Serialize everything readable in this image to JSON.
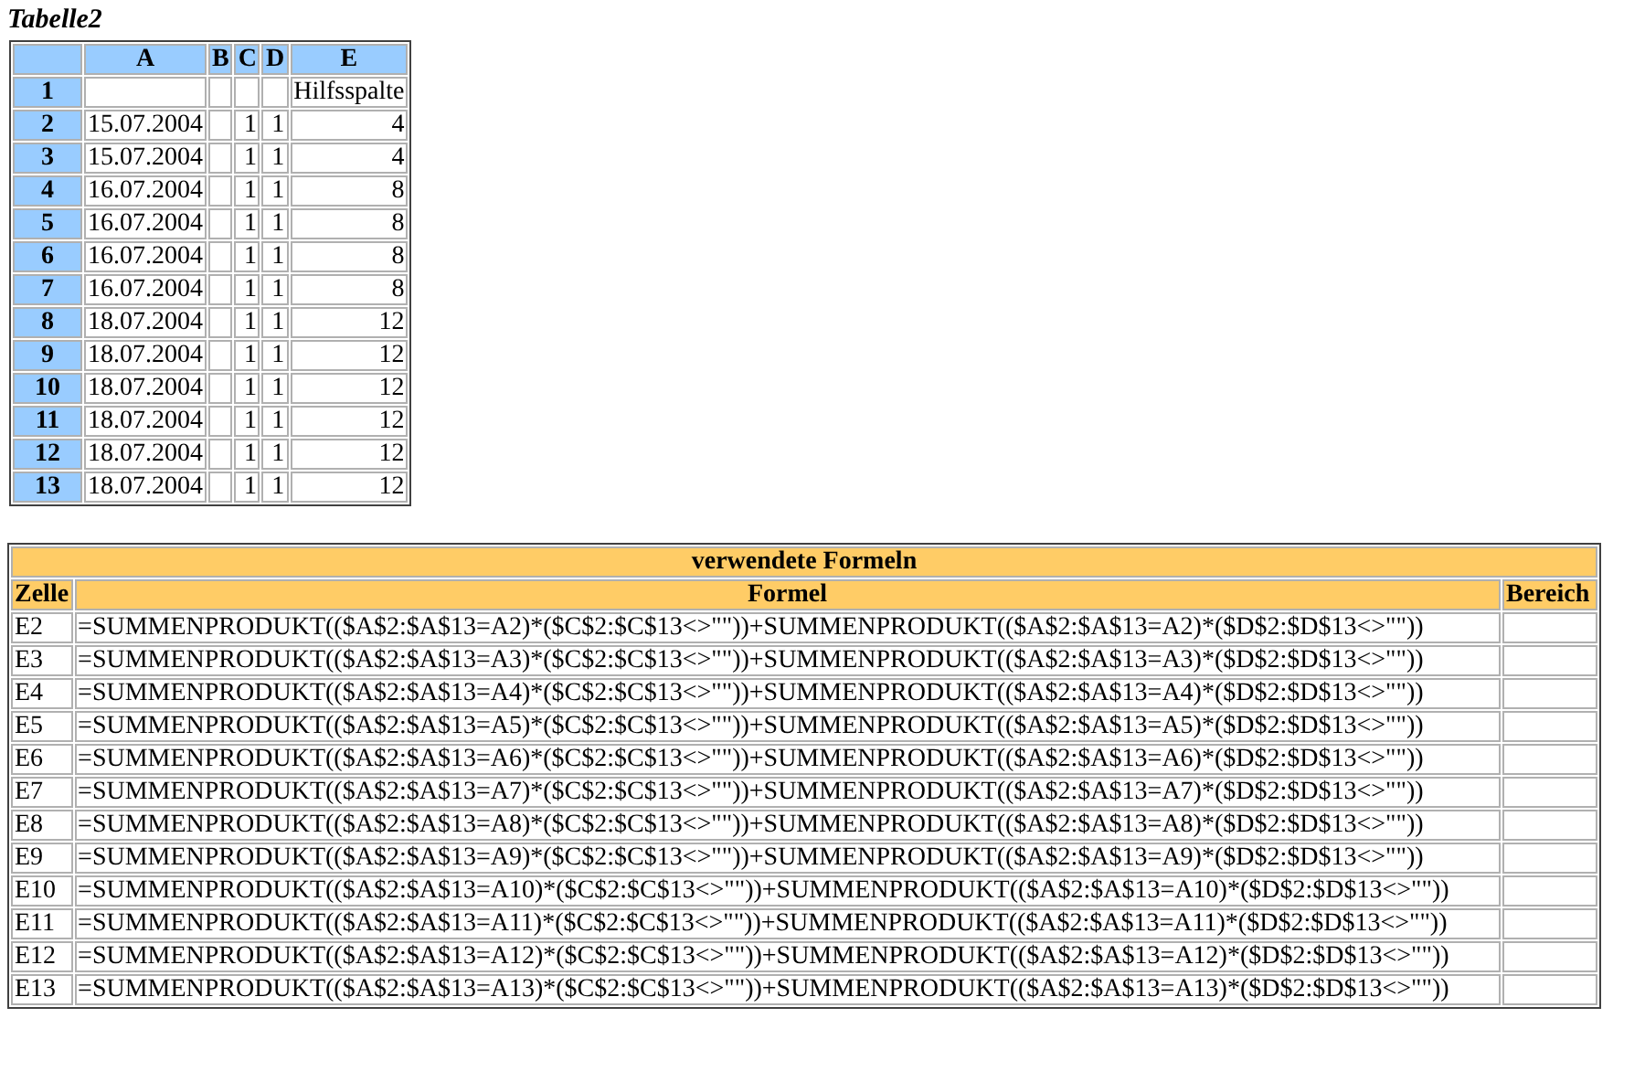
{
  "sheet": {
    "title": "Tabelle2",
    "columns": [
      "A",
      "B",
      "C",
      "D",
      "E"
    ],
    "rows": [
      {
        "number": "1",
        "cells": [
          "",
          "",
          "",
          "",
          "Hilfsspalte"
        ]
      },
      {
        "number": "2",
        "cells": [
          "15.07.2004",
          "",
          "1",
          "1",
          "4"
        ]
      },
      {
        "number": "3",
        "cells": [
          "15.07.2004",
          "",
          "1",
          "1",
          "4"
        ]
      },
      {
        "number": "4",
        "cells": [
          "16.07.2004",
          "",
          "1",
          "1",
          "8"
        ]
      },
      {
        "number": "5",
        "cells": [
          "16.07.2004",
          "",
          "1",
          "1",
          "8"
        ]
      },
      {
        "number": "6",
        "cells": [
          "16.07.2004",
          "",
          "1",
          "1",
          "8"
        ]
      },
      {
        "number": "7",
        "cells": [
          "16.07.2004",
          "",
          "1",
          "1",
          "8"
        ]
      },
      {
        "number": "8",
        "cells": [
          "18.07.2004",
          "",
          "1",
          "1",
          "12"
        ]
      },
      {
        "number": "9",
        "cells": [
          "18.07.2004",
          "",
          "1",
          "1",
          "12"
        ]
      },
      {
        "number": "10",
        "cells": [
          "18.07.2004",
          "",
          "1",
          "1",
          "12"
        ]
      },
      {
        "number": "11",
        "cells": [
          "18.07.2004",
          "",
          "1",
          "1",
          "12"
        ]
      },
      {
        "number": "12",
        "cells": [
          "18.07.2004",
          "",
          "1",
          "1",
          "12"
        ]
      },
      {
        "number": "13",
        "cells": [
          "18.07.2004",
          "",
          "1",
          "1",
          "12"
        ]
      }
    ]
  },
  "formulas": {
    "title": "verwendete Formeln",
    "columns": [
      "Zelle",
      "Formel",
      "Bereich"
    ],
    "rows": [
      {
        "cell": "E2",
        "formula": "=SUMMENPRODUKT(($A$2:$A$13=A2)*($C$2:$C$13<>\"\"))+SUMMENPRODUKT(($A$2:$A$13=A2)*($D$2:$D$13<>\"\"))"
      },
      {
        "cell": "E3",
        "formula": "=SUMMENPRODUKT(($A$2:$A$13=A3)*($C$2:$C$13<>\"\"))+SUMMENPRODUKT(($A$2:$A$13=A3)*($D$2:$D$13<>\"\"))"
      },
      {
        "cell": "E4",
        "formula": "=SUMMENPRODUKT(($A$2:$A$13=A4)*($C$2:$C$13<>\"\"))+SUMMENPRODUKT(($A$2:$A$13=A4)*($D$2:$D$13<>\"\"))"
      },
      {
        "cell": "E5",
        "formula": "=SUMMENPRODUKT(($A$2:$A$13=A5)*($C$2:$C$13<>\"\"))+SUMMENPRODUKT(($A$2:$A$13=A5)*($D$2:$D$13<>\"\"))"
      },
      {
        "cell": "E6",
        "formula": "=SUMMENPRODUKT(($A$2:$A$13=A6)*($C$2:$C$13<>\"\"))+SUMMENPRODUKT(($A$2:$A$13=A6)*($D$2:$D$13<>\"\"))"
      },
      {
        "cell": "E7",
        "formula": "=SUMMENPRODUKT(($A$2:$A$13=A7)*($C$2:$C$13<>\"\"))+SUMMENPRODUKT(($A$2:$A$13=A7)*($D$2:$D$13<>\"\"))"
      },
      {
        "cell": "E8",
        "formula": "=SUMMENPRODUKT(($A$2:$A$13=A8)*($C$2:$C$13<>\"\"))+SUMMENPRODUKT(($A$2:$A$13=A8)*($D$2:$D$13<>\"\"))"
      },
      {
        "cell": "E9",
        "formula": "=SUMMENPRODUKT(($A$2:$A$13=A9)*($C$2:$C$13<>\"\"))+SUMMENPRODUKT(($A$2:$A$13=A9)*($D$2:$D$13<>\"\"))"
      },
      {
        "cell": "E10",
        "formula": "=SUMMENPRODUKT(($A$2:$A$13=A10)*($C$2:$C$13<>\"\"))+SUMMENPRODUKT(($A$2:$A$13=A10)*($D$2:$D$13<>\"\"))"
      },
      {
        "cell": "E11",
        "formula": "=SUMMENPRODUKT(($A$2:$A$13=A11)*($C$2:$C$13<>\"\"))+SUMMENPRODUKT(($A$2:$A$13=A11)*($D$2:$D$13<>\"\"))"
      },
      {
        "cell": "E12",
        "formula": "=SUMMENPRODUKT(($A$2:$A$13=A12)*($C$2:$C$13<>\"\"))+SUMMENPRODUKT(($A$2:$A$13=A12)*($D$2:$D$13<>\"\"))"
      },
      {
        "cell": "E13",
        "formula": "=SUMMENPRODUKT(($A$2:$A$13=A13)*($C$2:$C$13<>\"\"))+SUMMENPRODUKT(($A$2:$A$13=A13)*($D$2:$D$13<>\"\"))"
      }
    ]
  }
}
